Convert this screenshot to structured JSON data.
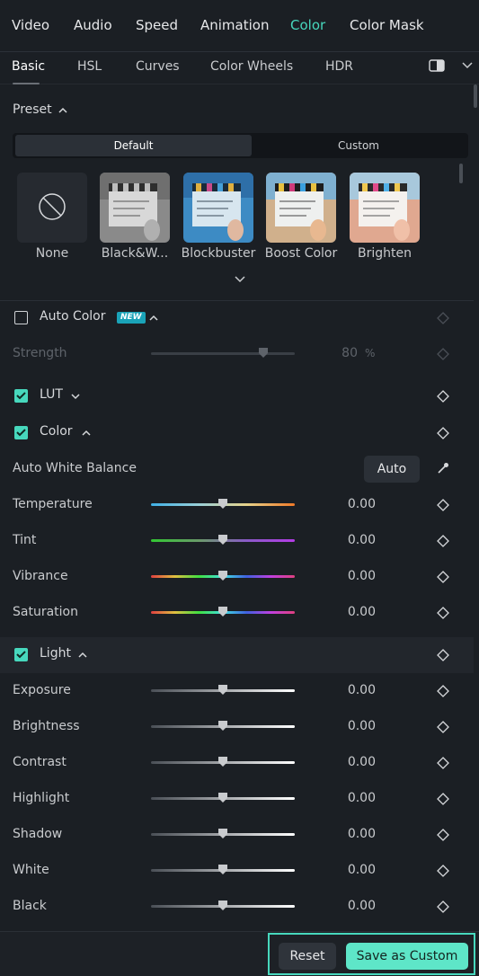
{
  "top_tabs": [
    "Video",
    "Audio",
    "Speed",
    "Animation",
    "Color",
    "Color Mask"
  ],
  "active_top_tab": "Color",
  "sub_tabs": [
    "Basic",
    "HSL",
    "Curves",
    "Color Wheels",
    "HDR"
  ],
  "active_sub_tab": "Basic",
  "preset": {
    "heading": "Preset",
    "segments": [
      "Default",
      "Custom"
    ],
    "selected_segment": "Default",
    "items": [
      {
        "label": "None",
        "icon": "none-circle-slash-icon"
      },
      {
        "label": "Black&W...",
        "tone": "black-white"
      },
      {
        "label": "Blockbuster",
        "tone": "blockbuster"
      },
      {
        "label": "Boost Color",
        "tone": "boost-color"
      },
      {
        "label": "Brighten",
        "tone": "brighten"
      }
    ]
  },
  "auto_color": {
    "label": "Auto Color",
    "badge": "NEW",
    "checked": false
  },
  "strength": {
    "label": "Strength",
    "value": "80",
    "unit": "%",
    "fraction": 0.78
  },
  "lut": {
    "label": "LUT",
    "checked": true
  },
  "color_section": {
    "label": "Color",
    "checked": true,
    "awb_label": "Auto White Balance",
    "auto_button": "Auto",
    "sliders": [
      {
        "label": "Temperature",
        "value": "0.00",
        "fraction": 0.5,
        "gradient": "temperature"
      },
      {
        "label": "Tint",
        "value": "0.00",
        "fraction": 0.5,
        "gradient": "tint"
      },
      {
        "label": "Vibrance",
        "value": "0.00",
        "fraction": 0.5,
        "gradient": "spectrum"
      },
      {
        "label": "Saturation",
        "value": "0.00",
        "fraction": 0.5,
        "gradient": "spectrum"
      }
    ]
  },
  "light_section": {
    "label": "Light",
    "checked": true,
    "sliders": [
      {
        "label": "Exposure",
        "value": "0.00",
        "fraction": 0.5
      },
      {
        "label": "Brightness",
        "value": "0.00",
        "fraction": 0.5
      },
      {
        "label": "Contrast",
        "value": "0.00",
        "fraction": 0.5
      },
      {
        "label": "Highlight",
        "value": "0.00",
        "fraction": 0.5
      },
      {
        "label": "Shadow",
        "value": "0.00",
        "fraction": 0.5
      },
      {
        "label": "White",
        "value": "0.00",
        "fraction": 0.5
      },
      {
        "label": "Black",
        "value": "0.00",
        "fraction": 0.5
      }
    ]
  },
  "footer": {
    "reset_label": "Reset",
    "save_label": "Save as Custom"
  },
  "colors": {
    "accent": "#47d8bd",
    "save_button": "#5ee6c8",
    "background": "#1b1f24"
  }
}
